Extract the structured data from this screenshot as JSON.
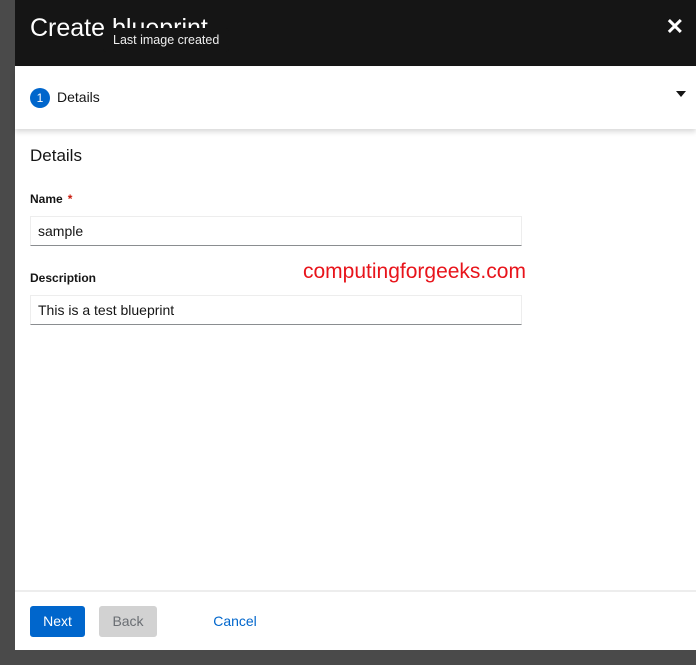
{
  "dialog": {
    "title": "Create blueprint",
    "tooltip": "Last image created",
    "close_icon": "close-icon"
  },
  "steps": [
    {
      "number": "1",
      "label": "Details"
    }
  ],
  "form": {
    "section_title": "Details",
    "name_label": "Name",
    "required_mark": "*",
    "name_value": "sample",
    "description_label": "Description",
    "description_value": "This is a test blueprint"
  },
  "watermark": "computingforgeeks.com",
  "footer": {
    "next": "Next",
    "back": "Back",
    "cancel": "Cancel"
  },
  "colors": {
    "primary": "#0066cc",
    "header": "#151515",
    "watermark": "#e8141b"
  }
}
